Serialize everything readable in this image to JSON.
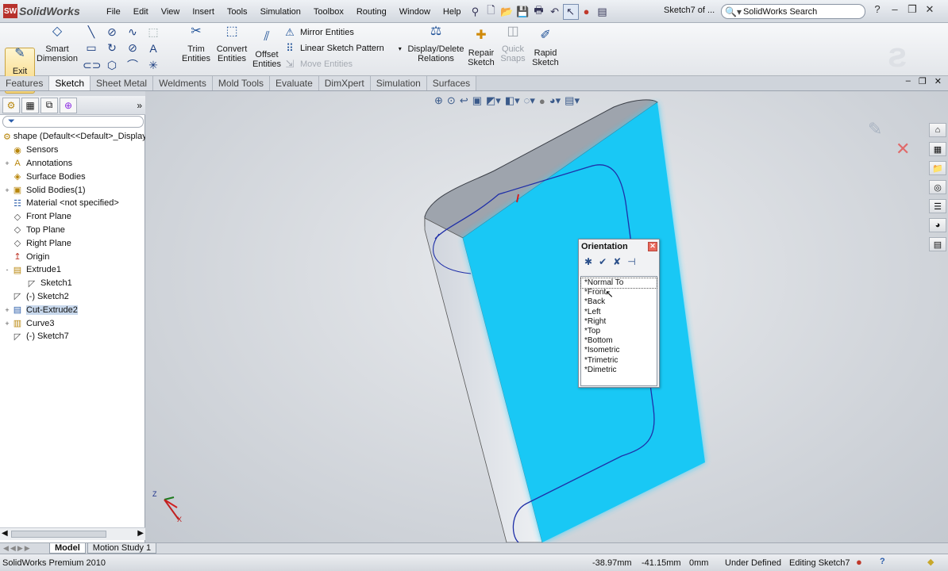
{
  "app": {
    "name": "SolidWorks",
    "document_title": "Sketch7 of ...",
    "search_placeholder": "SolidWorks Search"
  },
  "menu": [
    "File",
    "Edit",
    "View",
    "Insert",
    "Tools",
    "Simulation",
    "Toolbox",
    "Routing",
    "Window",
    "Help"
  ],
  "command_manager": {
    "exit_sketch": "Exit Sketch",
    "smart_dimension": "Smart Dimension",
    "trim_entities": "Trim Entities",
    "convert_entities": "Convert Entities",
    "offset_entities": "Offset Entities",
    "mirror_entities": "Mirror Entities",
    "linear_sketch_pattern": "Linear Sketch Pattern",
    "move_entities": "Move Entities",
    "display_delete_relations": "Display/Delete Relations",
    "repair_sketch": "Repair Sketch",
    "quick_snaps": "Quick Snaps",
    "rapid_sketch": "Rapid Sketch"
  },
  "tabs": [
    "Features",
    "Sketch",
    "Sheet Metal",
    "Weldments",
    "Mold Tools",
    "Evaluate",
    "DimXpert",
    "Simulation",
    "Surfaces"
  ],
  "active_tab": "Sketch",
  "tree": [
    {
      "label": "shape  (Default<<Default>_Display",
      "expand": "",
      "icon": "part"
    },
    {
      "label": "Sensors",
      "expand": "",
      "icon": "sensor"
    },
    {
      "label": "Annotations",
      "expand": "+",
      "icon": "annot"
    },
    {
      "label": "Surface Bodies",
      "expand": "",
      "icon": "surf"
    },
    {
      "label": "Solid Bodies(1)",
      "expand": "+",
      "icon": "solid"
    },
    {
      "label": "Material <not specified>",
      "expand": "",
      "icon": "material"
    },
    {
      "label": "Front Plane",
      "expand": "",
      "icon": "plane"
    },
    {
      "label": "Top Plane",
      "expand": "",
      "icon": "plane"
    },
    {
      "label": "Right Plane",
      "expand": "",
      "icon": "plane"
    },
    {
      "label": "Origin",
      "expand": "",
      "icon": "origin"
    },
    {
      "label": "Extrude1",
      "expand": "-",
      "icon": "extrude"
    },
    {
      "label": "Sketch1",
      "expand": "",
      "icon": "sketch"
    },
    {
      "label": "(-) Sketch2",
      "expand": "",
      "icon": "sketch"
    },
    {
      "label": "Cut-Extrude2",
      "expand": "+",
      "icon": "cut"
    },
    {
      "label": "Curve3",
      "expand": "+",
      "icon": "curve"
    },
    {
      "label": "(-) Sketch7",
      "expand": "",
      "icon": "sketch"
    }
  ],
  "orientation": {
    "title": "Orientation",
    "views": [
      "*Normal To",
      "*Front",
      "*Back",
      "*Left",
      "*Right",
      "*Top",
      "*Bottom",
      "*Isometric",
      "*Trimetric",
      "*Dimetric"
    ]
  },
  "bottom_tabs": [
    "Model",
    "Motion Study 1"
  ],
  "status": {
    "product": "SolidWorks Premium 2010",
    "x": "-38.97mm",
    "y": "-41.15mm",
    "z": "0mm",
    "state": "Under Defined",
    "editing": "Editing Sketch7"
  },
  "colors": {
    "face_highlight": "#19c8f5",
    "accent": "#1c4f96"
  }
}
